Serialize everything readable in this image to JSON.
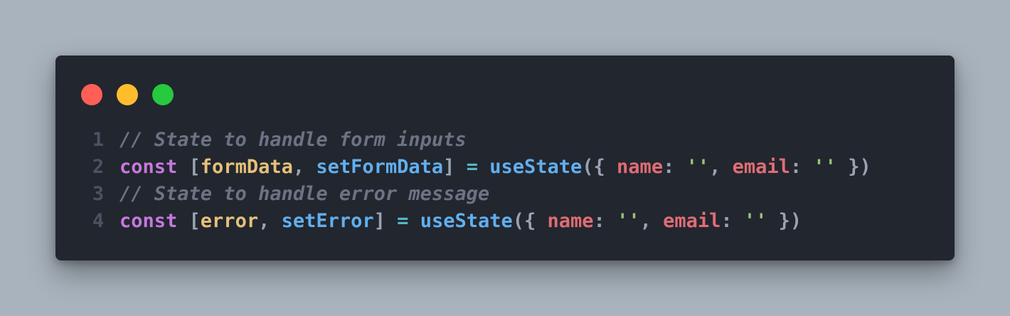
{
  "window": {
    "controls": [
      {
        "name": "close",
        "color": "#ff5f56"
      },
      {
        "name": "minimize",
        "color": "#ffbd2e"
      },
      {
        "name": "maximize",
        "color": "#27c93f"
      }
    ]
  },
  "code": {
    "lines": [
      {
        "number": "1",
        "tokens": [
          {
            "type": "comment",
            "text": "// State to handle form inputs"
          }
        ]
      },
      {
        "number": "2",
        "tokens": [
          {
            "type": "keyword",
            "text": "const"
          },
          {
            "type": "punct",
            "text": " ["
          },
          {
            "type": "var",
            "text": "formData"
          },
          {
            "type": "punct",
            "text": ", "
          },
          {
            "type": "func",
            "text": "setFormData"
          },
          {
            "type": "punct",
            "text": "] "
          },
          {
            "type": "op",
            "text": "="
          },
          {
            "type": "punct",
            "text": " "
          },
          {
            "type": "func",
            "text": "useState"
          },
          {
            "type": "punct",
            "text": "({ "
          },
          {
            "type": "prop",
            "text": "name"
          },
          {
            "type": "punct",
            "text": ": "
          },
          {
            "type": "str",
            "text": "''"
          },
          {
            "type": "punct",
            "text": ", "
          },
          {
            "type": "prop",
            "text": "email"
          },
          {
            "type": "punct",
            "text": ": "
          },
          {
            "type": "str",
            "text": "''"
          },
          {
            "type": "punct",
            "text": " })"
          }
        ]
      },
      {
        "number": "3",
        "tokens": [
          {
            "type": "comment",
            "text": "// State to handle error message"
          }
        ]
      },
      {
        "number": "4",
        "tokens": [
          {
            "type": "keyword",
            "text": "const"
          },
          {
            "type": "punct",
            "text": " ["
          },
          {
            "type": "var",
            "text": "error"
          },
          {
            "type": "punct",
            "text": ", "
          },
          {
            "type": "func",
            "text": "setError"
          },
          {
            "type": "punct",
            "text": "] "
          },
          {
            "type": "op",
            "text": "="
          },
          {
            "type": "punct",
            "text": " "
          },
          {
            "type": "func",
            "text": "useState"
          },
          {
            "type": "punct",
            "text": "({ "
          },
          {
            "type": "prop",
            "text": "name"
          },
          {
            "type": "punct",
            "text": ": "
          },
          {
            "type": "str",
            "text": "''"
          },
          {
            "type": "punct",
            "text": ", "
          },
          {
            "type": "prop",
            "text": "email"
          },
          {
            "type": "punct",
            "text": ": "
          },
          {
            "type": "str",
            "text": "''"
          },
          {
            "type": "punct",
            "text": " })"
          }
        ]
      }
    ]
  }
}
